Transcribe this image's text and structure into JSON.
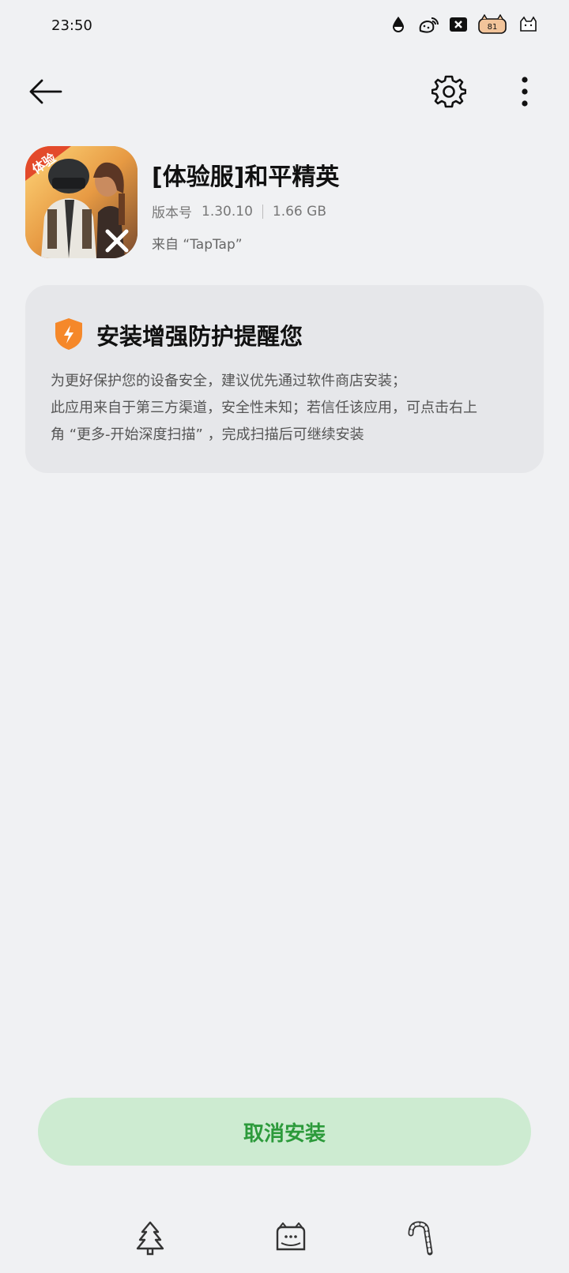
{
  "status_bar": {
    "time": "23:50",
    "icons": [
      "water-drop-icon",
      "wifi-strawberry-icon",
      "close-box-icon",
      "battery-icon",
      "cat-icon"
    ],
    "battery_level": "81"
  },
  "topbar": {
    "icons": [
      "back-arrow-icon",
      "gear-icon",
      "more-vert-icon"
    ]
  },
  "app": {
    "icon_badge": "体验",
    "name": "[体验服]和平精英",
    "version_label": "版本号",
    "version": "1.30.10",
    "size": "1.66 GB",
    "source": "来自 “TapTap”"
  },
  "warning": {
    "title": "安装增强防护提醒您",
    "lines": [
      "为更好保护您的设备安全，建议优先通过软件商店安装；",
      "此应用来自于第三方渠道，安全性未知；若信任该应用，可点击右上",
      "角 “更多-开始深度扫描” ，完成扫描后可继续安装"
    ],
    "accent_color": "#f5882a"
  },
  "actions": {
    "cancel_label": "取消安装",
    "cancel_color": "#2c9a3b",
    "cancel_bg": "#cdebd1"
  },
  "navbar": {
    "icons": [
      "tree-icon",
      "cat-home-icon",
      "candy-cane-icon"
    ]
  }
}
